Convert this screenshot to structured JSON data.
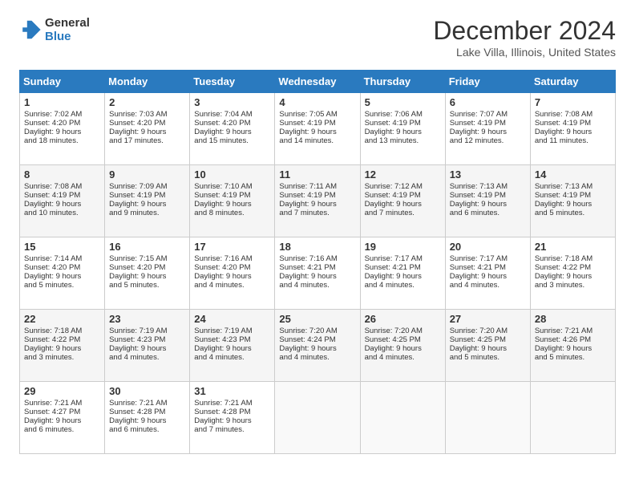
{
  "header": {
    "logo_line1": "General",
    "logo_line2": "Blue",
    "month": "December 2024",
    "location": "Lake Villa, Illinois, United States"
  },
  "days_of_week": [
    "Sunday",
    "Monday",
    "Tuesday",
    "Wednesday",
    "Thursday",
    "Friday",
    "Saturday"
  ],
  "weeks": [
    [
      {
        "day": "1",
        "lines": [
          "Sunrise: 7:02 AM",
          "Sunset: 4:20 PM",
          "Daylight: 9 hours",
          "and 18 minutes."
        ]
      },
      {
        "day": "2",
        "lines": [
          "Sunrise: 7:03 AM",
          "Sunset: 4:20 PM",
          "Daylight: 9 hours",
          "and 17 minutes."
        ]
      },
      {
        "day": "3",
        "lines": [
          "Sunrise: 7:04 AM",
          "Sunset: 4:20 PM",
          "Daylight: 9 hours",
          "and 15 minutes."
        ]
      },
      {
        "day": "4",
        "lines": [
          "Sunrise: 7:05 AM",
          "Sunset: 4:19 PM",
          "Daylight: 9 hours",
          "and 14 minutes."
        ]
      },
      {
        "day": "5",
        "lines": [
          "Sunrise: 7:06 AM",
          "Sunset: 4:19 PM",
          "Daylight: 9 hours",
          "and 13 minutes."
        ]
      },
      {
        "day": "6",
        "lines": [
          "Sunrise: 7:07 AM",
          "Sunset: 4:19 PM",
          "Daylight: 9 hours",
          "and 12 minutes."
        ]
      },
      {
        "day": "7",
        "lines": [
          "Sunrise: 7:08 AM",
          "Sunset: 4:19 PM",
          "Daylight: 9 hours",
          "and 11 minutes."
        ]
      }
    ],
    [
      {
        "day": "8",
        "lines": [
          "Sunrise: 7:08 AM",
          "Sunset: 4:19 PM",
          "Daylight: 9 hours",
          "and 10 minutes."
        ]
      },
      {
        "day": "9",
        "lines": [
          "Sunrise: 7:09 AM",
          "Sunset: 4:19 PM",
          "Daylight: 9 hours",
          "and 9 minutes."
        ]
      },
      {
        "day": "10",
        "lines": [
          "Sunrise: 7:10 AM",
          "Sunset: 4:19 PM",
          "Daylight: 9 hours",
          "and 8 minutes."
        ]
      },
      {
        "day": "11",
        "lines": [
          "Sunrise: 7:11 AM",
          "Sunset: 4:19 PM",
          "Daylight: 9 hours",
          "and 7 minutes."
        ]
      },
      {
        "day": "12",
        "lines": [
          "Sunrise: 7:12 AM",
          "Sunset: 4:19 PM",
          "Daylight: 9 hours",
          "and 7 minutes."
        ]
      },
      {
        "day": "13",
        "lines": [
          "Sunrise: 7:13 AM",
          "Sunset: 4:19 PM",
          "Daylight: 9 hours",
          "and 6 minutes."
        ]
      },
      {
        "day": "14",
        "lines": [
          "Sunrise: 7:13 AM",
          "Sunset: 4:19 PM",
          "Daylight: 9 hours",
          "and 5 minutes."
        ]
      }
    ],
    [
      {
        "day": "15",
        "lines": [
          "Sunrise: 7:14 AM",
          "Sunset: 4:20 PM",
          "Daylight: 9 hours",
          "and 5 minutes."
        ]
      },
      {
        "day": "16",
        "lines": [
          "Sunrise: 7:15 AM",
          "Sunset: 4:20 PM",
          "Daylight: 9 hours",
          "and 5 minutes."
        ]
      },
      {
        "day": "17",
        "lines": [
          "Sunrise: 7:16 AM",
          "Sunset: 4:20 PM",
          "Daylight: 9 hours",
          "and 4 minutes."
        ]
      },
      {
        "day": "18",
        "lines": [
          "Sunrise: 7:16 AM",
          "Sunset: 4:21 PM",
          "Daylight: 9 hours",
          "and 4 minutes."
        ]
      },
      {
        "day": "19",
        "lines": [
          "Sunrise: 7:17 AM",
          "Sunset: 4:21 PM",
          "Daylight: 9 hours",
          "and 4 minutes."
        ]
      },
      {
        "day": "20",
        "lines": [
          "Sunrise: 7:17 AM",
          "Sunset: 4:21 PM",
          "Daylight: 9 hours",
          "and 4 minutes."
        ]
      },
      {
        "day": "21",
        "lines": [
          "Sunrise: 7:18 AM",
          "Sunset: 4:22 PM",
          "Daylight: 9 hours",
          "and 3 minutes."
        ]
      }
    ],
    [
      {
        "day": "22",
        "lines": [
          "Sunrise: 7:18 AM",
          "Sunset: 4:22 PM",
          "Daylight: 9 hours",
          "and 3 minutes."
        ]
      },
      {
        "day": "23",
        "lines": [
          "Sunrise: 7:19 AM",
          "Sunset: 4:23 PM",
          "Daylight: 9 hours",
          "and 4 minutes."
        ]
      },
      {
        "day": "24",
        "lines": [
          "Sunrise: 7:19 AM",
          "Sunset: 4:23 PM",
          "Daylight: 9 hours",
          "and 4 minutes."
        ]
      },
      {
        "day": "25",
        "lines": [
          "Sunrise: 7:20 AM",
          "Sunset: 4:24 PM",
          "Daylight: 9 hours",
          "and 4 minutes."
        ]
      },
      {
        "day": "26",
        "lines": [
          "Sunrise: 7:20 AM",
          "Sunset: 4:25 PM",
          "Daylight: 9 hours",
          "and 4 minutes."
        ]
      },
      {
        "day": "27",
        "lines": [
          "Sunrise: 7:20 AM",
          "Sunset: 4:25 PM",
          "Daylight: 9 hours",
          "and 5 minutes."
        ]
      },
      {
        "day": "28",
        "lines": [
          "Sunrise: 7:21 AM",
          "Sunset: 4:26 PM",
          "Daylight: 9 hours",
          "and 5 minutes."
        ]
      }
    ],
    [
      {
        "day": "29",
        "lines": [
          "Sunrise: 7:21 AM",
          "Sunset: 4:27 PM",
          "Daylight: 9 hours",
          "and 6 minutes."
        ]
      },
      {
        "day": "30",
        "lines": [
          "Sunrise: 7:21 AM",
          "Sunset: 4:28 PM",
          "Daylight: 9 hours",
          "and 6 minutes."
        ]
      },
      {
        "day": "31",
        "lines": [
          "Sunrise: 7:21 AM",
          "Sunset: 4:28 PM",
          "Daylight: 9 hours",
          "and 7 minutes."
        ]
      },
      null,
      null,
      null,
      null
    ]
  ]
}
